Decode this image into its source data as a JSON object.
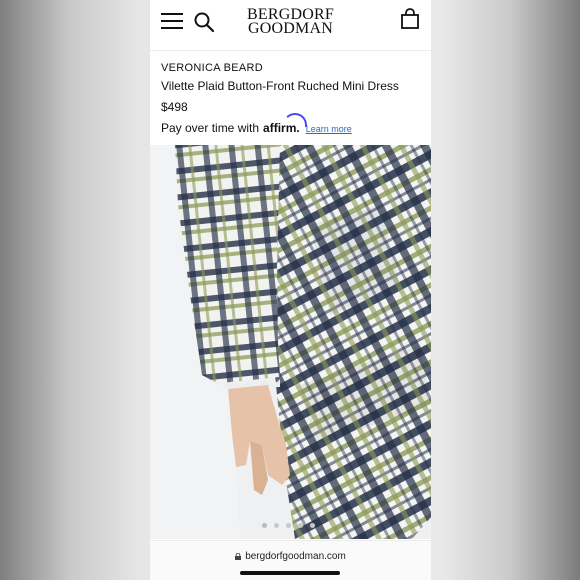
{
  "header": {
    "logo_line1": "BERGDORF",
    "logo_line2": "GOODMAN"
  },
  "product": {
    "brand": "VERONICA BEARD",
    "title": "Vilette Plaid Button-Front Ruched Mini Dress",
    "price": "$498",
    "financing_text": "Pay over time with",
    "affirm_brand": "affirm",
    "learn_more": "Learn more"
  },
  "gallery": {
    "dot_count": 5,
    "active_index": 0
  },
  "browser": {
    "url": "bergdorfgoodman.com"
  },
  "colors": {
    "plaid_navy": "#253149",
    "plaid_olive": "#8c9a5a",
    "plaid_white": "#f4f4f2",
    "link": "#2a6ac9",
    "affirm_arc": "#4a4af4"
  }
}
